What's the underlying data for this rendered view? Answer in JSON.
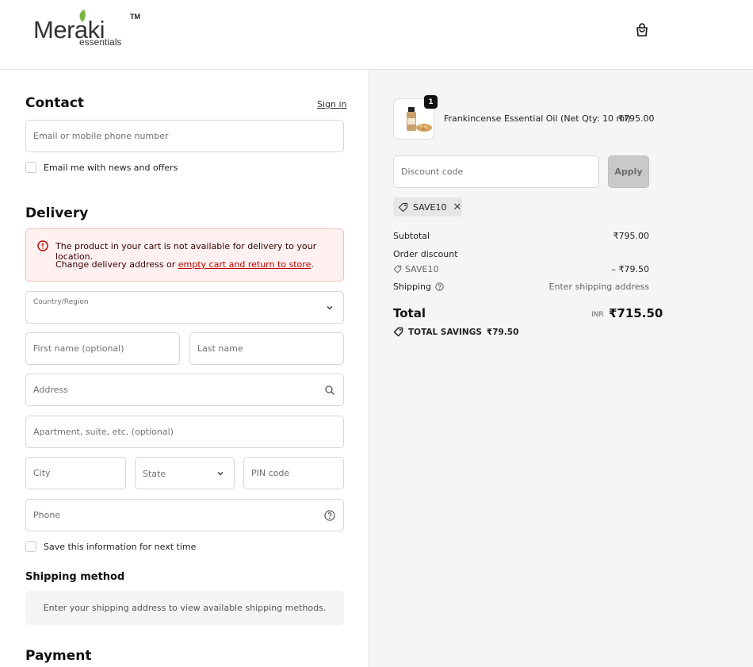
{
  "brand": {
    "logo_main": "Meraki",
    "logo_sub": "essentials",
    "logo_tm": "TM"
  },
  "contact": {
    "heading": "Contact",
    "sign_in": "Sign in",
    "email_placeholder": "Email or mobile phone number",
    "news_label": "Email me with news and offers"
  },
  "delivery": {
    "heading": "Delivery",
    "alert": {
      "title": "The product in your cart is not available for delivery to your location.",
      "body_prefix": "Change delivery address or ",
      "body_link": "empty cart and return to store",
      "body_suffix": "."
    },
    "country_label": "Country/Region",
    "first_name_placeholder": "First name (optional)",
    "last_name_placeholder": "Last name",
    "address_placeholder": "Address",
    "apartment_placeholder": "Apartment, suite, etc. (optional)",
    "city_placeholder": "City",
    "state_placeholder": "State",
    "pin_placeholder": "PIN code",
    "phone_placeholder": "Phone",
    "save_info_label": "Save this information for next time"
  },
  "shipping": {
    "heading": "Shipping method",
    "message": "Enter your shipping address to view available shipping methods."
  },
  "payment": {
    "heading": "Payment"
  },
  "summary": {
    "product": {
      "name": "Frankincense Essential Oil (Net Qty: 10 ml)",
      "price": "₹795.00",
      "quantity": "1"
    },
    "discount_placeholder": "Discount code",
    "apply_label": "Apply",
    "applied_code": "SAVE10",
    "subtotal_label": "Subtotal",
    "subtotal_value": "₹795.00",
    "order_discount_label": "Order discount",
    "discount_code": "SAVE10",
    "discount_value": "– ₹79.50",
    "shipping_label": "Shipping",
    "shipping_value": "Enter shipping address",
    "total_label": "Total",
    "currency": "INR",
    "total_value": "₹715.50",
    "savings_label": "TOTAL SAVINGS",
    "savings_value": "₹79.50"
  },
  "colors": {
    "alert_bg": "#fff1f1",
    "alert_link": "#c00000",
    "summary_bg": "#f5f5f5",
    "apply_bg": "#c9c9c9"
  }
}
